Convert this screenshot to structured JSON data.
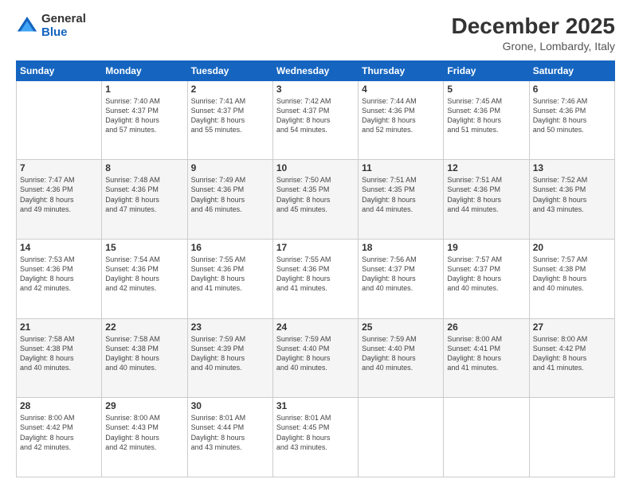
{
  "logo": {
    "general": "General",
    "blue": "Blue"
  },
  "header": {
    "title": "December 2025",
    "subtitle": "Grone, Lombardy, Italy"
  },
  "days_of_week": [
    "Sunday",
    "Monday",
    "Tuesday",
    "Wednesday",
    "Thursday",
    "Friday",
    "Saturday"
  ],
  "weeks": [
    [
      {
        "day": "",
        "content": ""
      },
      {
        "day": "1",
        "content": "Sunrise: 7:40 AM\nSunset: 4:37 PM\nDaylight: 8 hours\nand 57 minutes."
      },
      {
        "day": "2",
        "content": "Sunrise: 7:41 AM\nSunset: 4:37 PM\nDaylight: 8 hours\nand 55 minutes."
      },
      {
        "day": "3",
        "content": "Sunrise: 7:42 AM\nSunset: 4:37 PM\nDaylight: 8 hours\nand 54 minutes."
      },
      {
        "day": "4",
        "content": "Sunrise: 7:44 AM\nSunset: 4:36 PM\nDaylight: 8 hours\nand 52 minutes."
      },
      {
        "day": "5",
        "content": "Sunrise: 7:45 AM\nSunset: 4:36 PM\nDaylight: 8 hours\nand 51 minutes."
      },
      {
        "day": "6",
        "content": "Sunrise: 7:46 AM\nSunset: 4:36 PM\nDaylight: 8 hours\nand 50 minutes."
      }
    ],
    [
      {
        "day": "7",
        "content": "Sunrise: 7:47 AM\nSunset: 4:36 PM\nDaylight: 8 hours\nand 49 minutes."
      },
      {
        "day": "8",
        "content": "Sunrise: 7:48 AM\nSunset: 4:36 PM\nDaylight: 8 hours\nand 47 minutes."
      },
      {
        "day": "9",
        "content": "Sunrise: 7:49 AM\nSunset: 4:36 PM\nDaylight: 8 hours\nand 46 minutes."
      },
      {
        "day": "10",
        "content": "Sunrise: 7:50 AM\nSunset: 4:35 PM\nDaylight: 8 hours\nand 45 minutes."
      },
      {
        "day": "11",
        "content": "Sunrise: 7:51 AM\nSunset: 4:35 PM\nDaylight: 8 hours\nand 44 minutes."
      },
      {
        "day": "12",
        "content": "Sunrise: 7:51 AM\nSunset: 4:36 PM\nDaylight: 8 hours\nand 44 minutes."
      },
      {
        "day": "13",
        "content": "Sunrise: 7:52 AM\nSunset: 4:36 PM\nDaylight: 8 hours\nand 43 minutes."
      }
    ],
    [
      {
        "day": "14",
        "content": "Sunrise: 7:53 AM\nSunset: 4:36 PM\nDaylight: 8 hours\nand 42 minutes."
      },
      {
        "day": "15",
        "content": "Sunrise: 7:54 AM\nSunset: 4:36 PM\nDaylight: 8 hours\nand 42 minutes."
      },
      {
        "day": "16",
        "content": "Sunrise: 7:55 AM\nSunset: 4:36 PM\nDaylight: 8 hours\nand 41 minutes."
      },
      {
        "day": "17",
        "content": "Sunrise: 7:55 AM\nSunset: 4:36 PM\nDaylight: 8 hours\nand 41 minutes."
      },
      {
        "day": "18",
        "content": "Sunrise: 7:56 AM\nSunset: 4:37 PM\nDaylight: 8 hours\nand 40 minutes."
      },
      {
        "day": "19",
        "content": "Sunrise: 7:57 AM\nSunset: 4:37 PM\nDaylight: 8 hours\nand 40 minutes."
      },
      {
        "day": "20",
        "content": "Sunrise: 7:57 AM\nSunset: 4:38 PM\nDaylight: 8 hours\nand 40 minutes."
      }
    ],
    [
      {
        "day": "21",
        "content": "Sunrise: 7:58 AM\nSunset: 4:38 PM\nDaylight: 8 hours\nand 40 minutes."
      },
      {
        "day": "22",
        "content": "Sunrise: 7:58 AM\nSunset: 4:38 PM\nDaylight: 8 hours\nand 40 minutes."
      },
      {
        "day": "23",
        "content": "Sunrise: 7:59 AM\nSunset: 4:39 PM\nDaylight: 8 hours\nand 40 minutes."
      },
      {
        "day": "24",
        "content": "Sunrise: 7:59 AM\nSunset: 4:40 PM\nDaylight: 8 hours\nand 40 minutes."
      },
      {
        "day": "25",
        "content": "Sunrise: 7:59 AM\nSunset: 4:40 PM\nDaylight: 8 hours\nand 40 minutes."
      },
      {
        "day": "26",
        "content": "Sunrise: 8:00 AM\nSunset: 4:41 PM\nDaylight: 8 hours\nand 41 minutes."
      },
      {
        "day": "27",
        "content": "Sunrise: 8:00 AM\nSunset: 4:42 PM\nDaylight: 8 hours\nand 41 minutes."
      }
    ],
    [
      {
        "day": "28",
        "content": "Sunrise: 8:00 AM\nSunset: 4:42 PM\nDaylight: 8 hours\nand 42 minutes."
      },
      {
        "day": "29",
        "content": "Sunrise: 8:00 AM\nSunset: 4:43 PM\nDaylight: 8 hours\nand 42 minutes."
      },
      {
        "day": "30",
        "content": "Sunrise: 8:01 AM\nSunset: 4:44 PM\nDaylight: 8 hours\nand 43 minutes."
      },
      {
        "day": "31",
        "content": "Sunrise: 8:01 AM\nSunset: 4:45 PM\nDaylight: 8 hours\nand 43 minutes."
      },
      {
        "day": "",
        "content": ""
      },
      {
        "day": "",
        "content": ""
      },
      {
        "day": "",
        "content": ""
      }
    ]
  ]
}
